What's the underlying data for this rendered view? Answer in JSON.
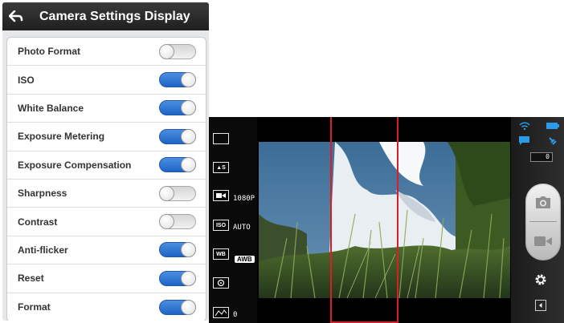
{
  "header": {
    "title": "Camera Settings Display"
  },
  "settings": [
    {
      "label": "Photo Format",
      "enabled": false
    },
    {
      "label": "ISO",
      "enabled": true
    },
    {
      "label": "White Balance",
      "enabled": true
    },
    {
      "label": "Exposure Metering",
      "enabled": true
    },
    {
      "label": "Exposure Compensation",
      "enabled": true
    },
    {
      "label": "Sharpness",
      "enabled": false
    },
    {
      "label": "Contrast",
      "enabled": false
    },
    {
      "label": "Anti-flicker",
      "enabled": true
    },
    {
      "label": "Reset",
      "enabled": true
    },
    {
      "label": "Format",
      "enabled": true
    }
  ],
  "camera": {
    "video_res_icon": "video-camera-icon",
    "video_resolution": "1080P",
    "iso_icon_label": "ISO",
    "iso_value": "AUTO",
    "wb_icon_label": "WB",
    "wb_value": "AWB",
    "ev_value": "0",
    "remaining_counter": "0",
    "icons": [
      "wifi-icon",
      "battery-icon",
      "message-icon",
      "satellite-icon",
      "photo-camera-icon",
      "video-camera-icon",
      "gear-icon",
      "play-icon"
    ]
  },
  "colors": {
    "toggle_on": "#2a73d6",
    "toggle_off": "#dcdcdc",
    "titlebar": "#2b2b2b",
    "highlight_frame": "#d81f26",
    "status_icons": "#2a9be8"
  }
}
